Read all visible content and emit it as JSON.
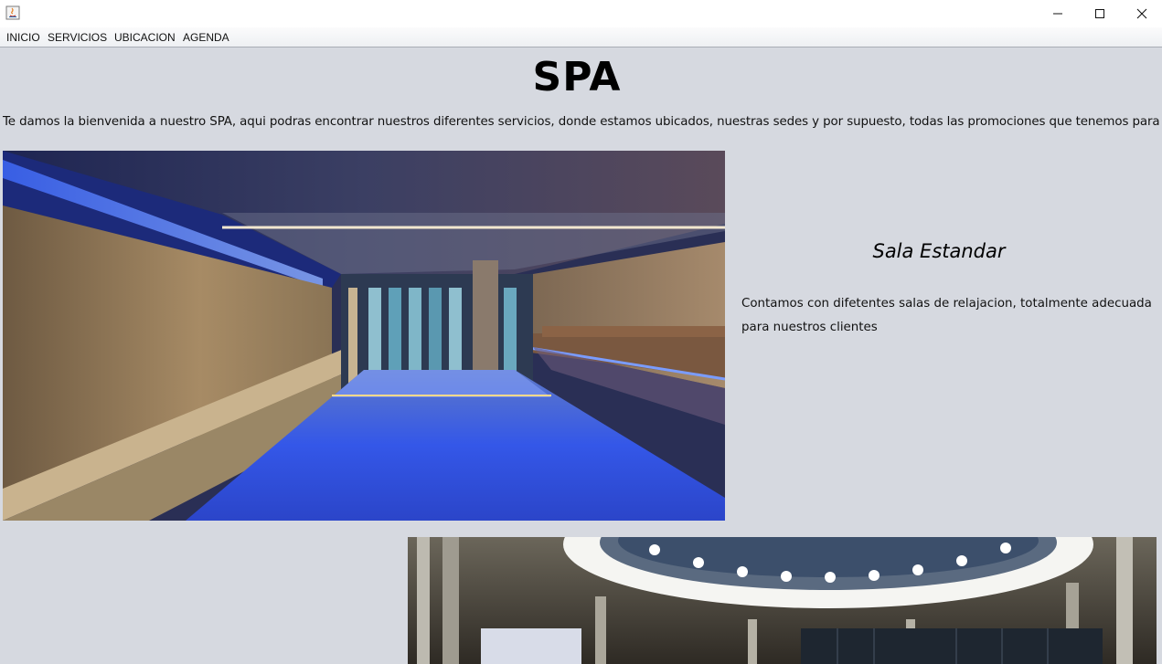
{
  "window": {
    "icon": "java-app-icon",
    "controls": [
      "minimize-icon",
      "maximize-icon",
      "close-icon"
    ]
  },
  "menu": {
    "items": [
      {
        "label": "INICIO"
      },
      {
        "label": "SERVICIOS"
      },
      {
        "label": "UBICACION"
      },
      {
        "label": "AGENDA"
      }
    ]
  },
  "page": {
    "title": "SPA",
    "intro": "Te damos la bienvenida a nuestro SPA, aqui podras encontrar nuestros diferentes servicios, donde estamos ubicados, nuestras sedes y por supuesto, todas las promociones que tenemos para ti"
  },
  "room": {
    "title": "Sala Estandar",
    "description": "Contamos con difetentes salas de relajacion, totalmente adecuada para nuestros clientes"
  },
  "colors": {
    "background": "#d6d9e0",
    "pool_blue": "#3a5cff",
    "wall_wood": "#9d8260"
  }
}
